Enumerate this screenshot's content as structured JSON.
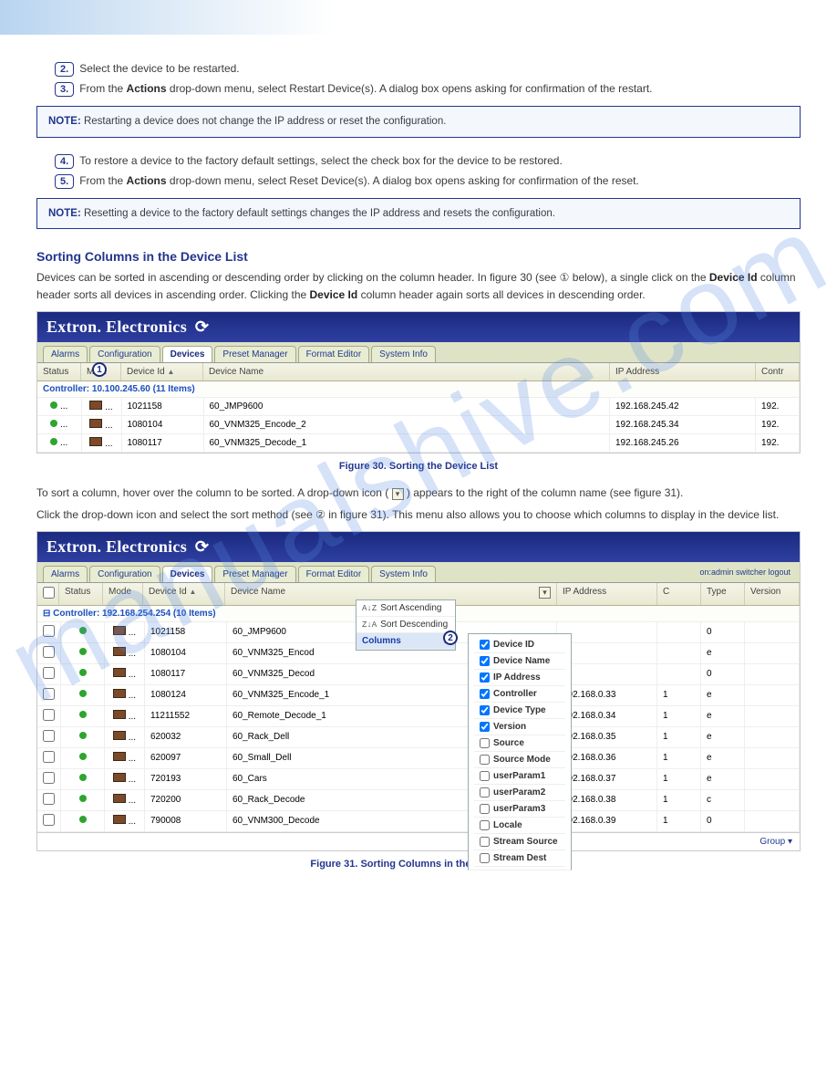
{
  "watermark": "manualshive.com",
  "ellipsis": "...",
  "steps": {
    "s2": {
      "num": "2.",
      "text": "Select the device to be restarted."
    },
    "s3": {
      "num": "3.",
      "text_pre": "From the",
      "bold": "Actions",
      "text_post": " drop-down menu, select Restart Device(s). A dialog box opens asking for confirmation of the restart."
    },
    "s4": {
      "num": "4.",
      "text": "To restore a device to the factory default settings, select the check box for the device to be restored."
    },
    "s5": {
      "num": "5.",
      "text_pre": "From the",
      "bold": "Actions",
      "text_post": " drop-down menu, select Reset Device(s). A dialog box opens asking for confirmation of the reset."
    }
  },
  "note1": {
    "label": "NOTE:",
    "text": "Restarting a device does not change the IP address or reset the configuration."
  },
  "note2": {
    "label": "NOTE:",
    "text": "Resetting a device to the factory default settings changes the IP address and resets the configuration."
  },
  "section": {
    "sorting_title": "Sorting Columns in the Device List",
    "sorting_body": {
      "pre": "Devices can be sorted in ascending or descending order by clicking on the column header. In figure 30 (see ① below), a single click on the",
      "bold1": "Device Id",
      "mid": "column header sorts all devices in ascending order. Clicking the",
      "bold2": "Device Id",
      "post": "column header again sorts all devices in descending order."
    },
    "col_sort": {
      "p1": "To sort a column, hover over the column to be sorted. A drop-down icon (",
      "p2": ") appears to the right of the column name (see figure 31).",
      "p3": "Click the drop-down icon and select the sort method (see ② in figure 31). This menu also allows you to choose which columns to display in the device list."
    }
  },
  "tabs": [
    "Alarms",
    "Configuration",
    "Devices",
    "Preset Manager",
    "Format Editor",
    "System Info"
  ],
  "cols": {
    "status": "Status",
    "mode": "Mode",
    "mode_short": "Mo...",
    "device_id": "Device Id",
    "device_name": "Device Name",
    "ip": "IP Address",
    "contr": "Contr",
    "c_short": "C",
    "type": "Type",
    "version": "Version"
  },
  "fig30": {
    "brand": "Extron. Electronics",
    "callout": "1",
    "group_label": "Controller: 10.100.245.60 (11 Items)",
    "rows": [
      {
        "id": "1021158",
        "name": "60_JMP9600",
        "ip": "192.168.245.42",
        "ctrl": "192."
      },
      {
        "id": "1080104",
        "name": "60_VNM325_Encode_2",
        "ip": "192.168.245.34",
        "ctrl": "192."
      },
      {
        "id": "1080117",
        "name": "60_VNM325_Decode_1",
        "ip": "192.168.245.26",
        "ctrl": "192."
      }
    ],
    "caption": "Figure 30. Sorting the Device List"
  },
  "fig31": {
    "topright": "on:admin  switcher  logout",
    "callout": "2",
    "group_label": "Controller: 192.168.254.254 (10 Items)",
    "sortmenu": [
      "Sort Ascending",
      "Sort Descending",
      "Columns"
    ],
    "colmenu": [
      "Device ID",
      "Device Name",
      "IP Address",
      "Controller",
      "Device Type",
      "Version",
      "Source",
      "Source Mode",
      "userParam1",
      "userParam2",
      "userParam3",
      "Locale",
      "Stream Source",
      "Stream Dest"
    ],
    "rows": [
      {
        "id": "1021158",
        "name": "60_JMP9600",
        "ip": "",
        "c": "",
        "t": "0"
      },
      {
        "id": "1080104",
        "name": "60_VNM325_Encod",
        "ip": "",
        "c": "",
        "t": "e"
      },
      {
        "id": "1080117",
        "name": "60_VNM325_Decod",
        "ip": "",
        "c": "",
        "t": "0"
      },
      {
        "id": "1080124",
        "name": "60_VNM325_Encode_1",
        "ip": "192.168.0.33",
        "c": "1",
        "t": "e"
      },
      {
        "id": "11211552",
        "name": "60_Remote_Decode_1",
        "ip": "192.168.0.34",
        "c": "1",
        "t": "e"
      },
      {
        "id": "620032",
        "name": "60_Rack_Dell",
        "ip": "192.168.0.35",
        "c": "1",
        "t": "e"
      },
      {
        "id": "620097",
        "name": "60_Small_Dell",
        "ip": "192.168.0.36",
        "c": "1",
        "t": "e"
      },
      {
        "id": "720193",
        "name": "60_Cars",
        "ip": "192.168.0.37",
        "c": "1",
        "t": "e"
      },
      {
        "id": "720200",
        "name": "60_Rack_Decode",
        "ip": "192.168.0.38",
        "c": "1",
        "t": "c"
      },
      {
        "id": "790008",
        "name": "60_VNM300_Decode",
        "ip": "192.168.0.39",
        "c": "1",
        "t": "0"
      }
    ],
    "group_btn": "Group",
    "caption": "Figure 31. Sorting Columns in the Device List"
  }
}
